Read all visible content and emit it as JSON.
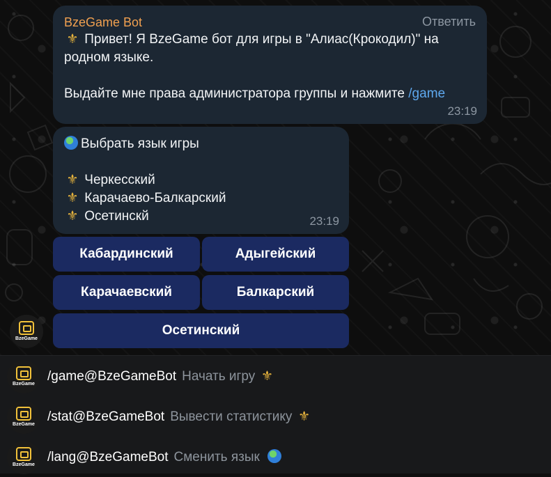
{
  "message1": {
    "sender": "BzeGame Bot",
    "reply_label": "Ответить",
    "line1": " Привет! Я BzeGame бот для игры в \"Алиас(Крокодил)\" на",
    "line2": "родном языке.",
    "line3_prefix": "Выдайте мне права администратора группы и нажмите ",
    "line3_command": "/game",
    "time": "23:19"
  },
  "message2": {
    "title": "Выбрать язык игры",
    "languages": [
      "Черкесский",
      "Карачаево-Балкарский",
      "Осетинскй"
    ],
    "time": "23:19"
  },
  "keyboard": {
    "btn_kabardian": "Кабардинский",
    "btn_adyghe": "Адыгейский",
    "btn_karachay": "Карачаевский",
    "btn_balkar": "Балкарский",
    "btn_ossetian": "Осетинский"
  },
  "bot_avatar": {
    "text": "BzeGame"
  },
  "commands": [
    {
      "command": "/game@BzeGameBot",
      "description": "Начать игру"
    },
    {
      "command": "/stat@BzeGameBot",
      "description": "Вывести  статистику"
    },
    {
      "command": "/lang@BzeGameBot",
      "description": "Сменить язык"
    }
  ],
  "colors": {
    "sender": "#f0a050",
    "bubble": "#1c2733",
    "button": "#1b2a61",
    "link": "#5ea8ee",
    "muted": "#8d97a2"
  },
  "icons": {
    "fleur": "fleur-de-lis-icon",
    "globe": "globe-icon"
  }
}
